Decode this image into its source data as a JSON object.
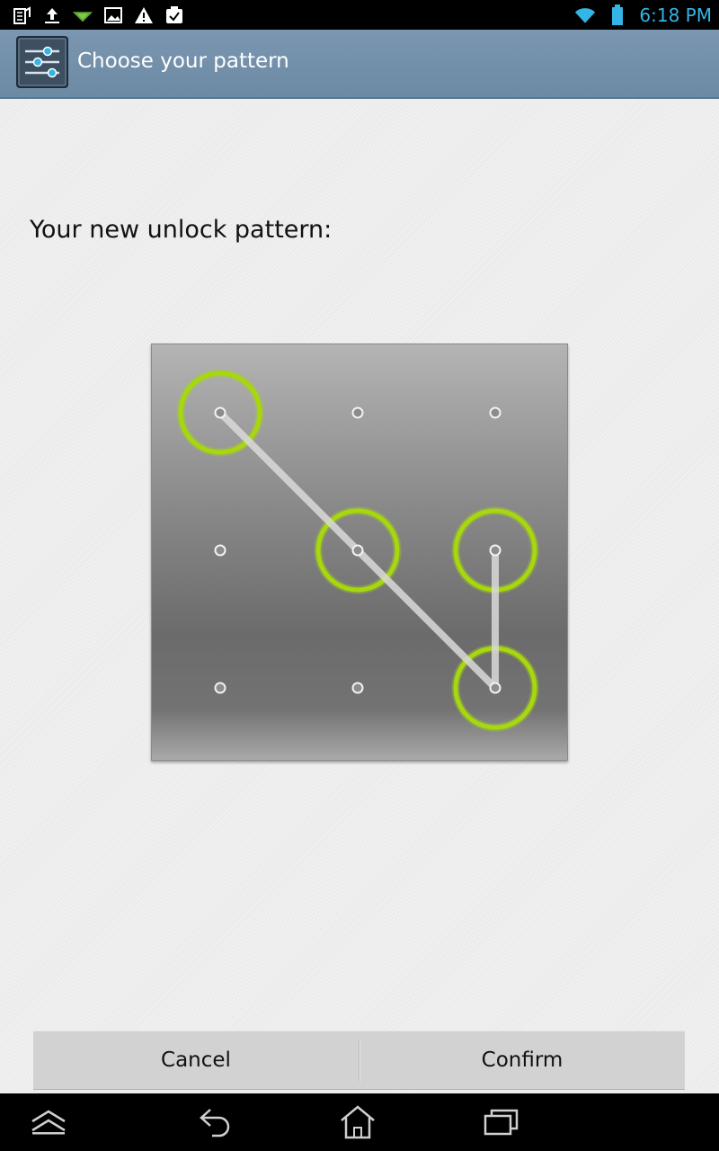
{
  "status_bar": {
    "time": "6:18 PM",
    "left_icons": [
      "sim-card-icon",
      "upload-icon",
      "signal-icon",
      "image-icon",
      "warning-icon",
      "task-icon"
    ],
    "right_icons": [
      "wifi-icon",
      "battery-icon"
    ],
    "accent_color": "#33b5e5"
  },
  "action_bar": {
    "title": "Choose your pattern",
    "icon": "settings-sliders-icon"
  },
  "content": {
    "heading": "Your new unlock pattern:"
  },
  "pattern": {
    "grid": [
      3,
      3
    ],
    "selected_sequence": [
      1,
      5,
      9,
      6
    ],
    "selected_color": "#a6d70f",
    "line_color": "#d9d9d9"
  },
  "buttons": {
    "cancel_label": "Cancel",
    "confirm_label": "Confirm"
  },
  "nav_bar": {
    "icons": [
      "menu-up-icon",
      "back-icon",
      "home-icon",
      "recent-apps-icon"
    ]
  }
}
